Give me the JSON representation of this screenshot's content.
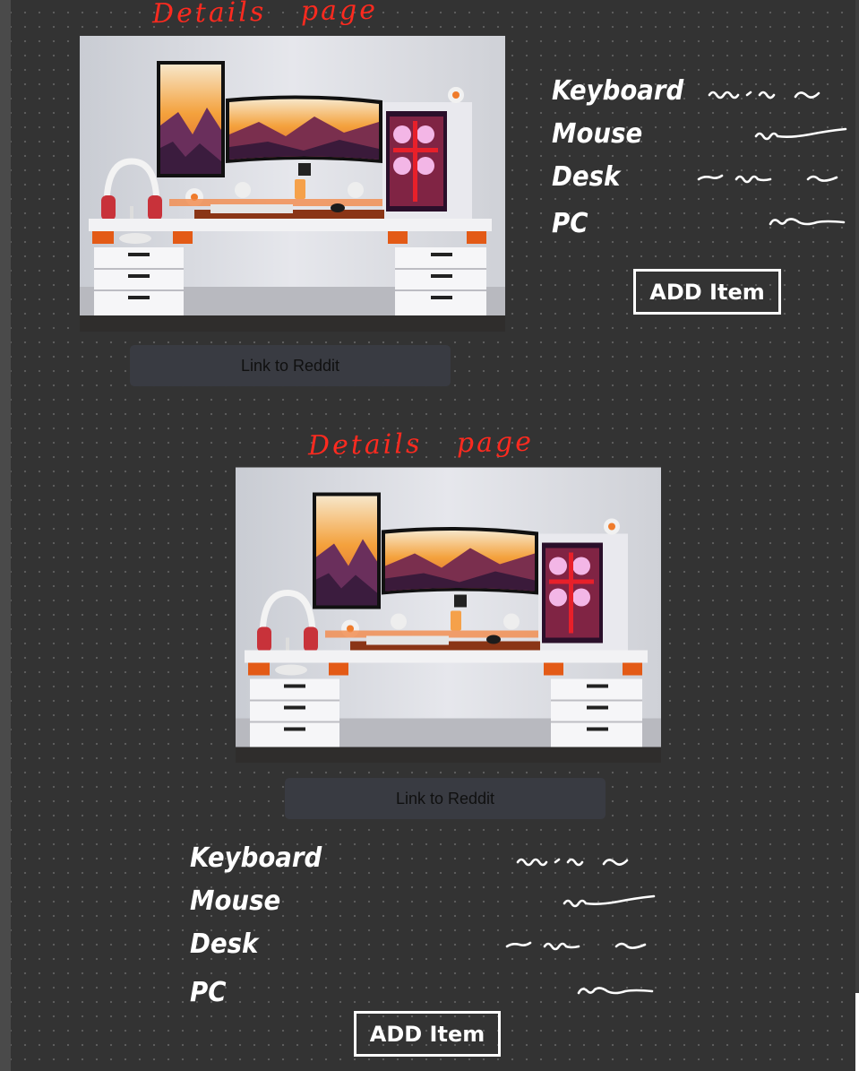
{
  "layout_a": {
    "title": "Details page",
    "link_label": "Link to Reddit",
    "specs": [
      {
        "label": "Keyboard"
      },
      {
        "label": "Mouse"
      },
      {
        "label": "Desk"
      },
      {
        "label": "PC"
      }
    ],
    "add_label": "ADD Item"
  },
  "layout_b": {
    "title": "Details page",
    "link_label": "Link to Reddit",
    "specs": [
      {
        "label": "Keyboard"
      },
      {
        "label": "Mouse"
      },
      {
        "label": "Desk"
      },
      {
        "label": "PC"
      }
    ],
    "add_label": "ADD Item"
  },
  "colors": {
    "annotation_red": "#ff2a1f",
    "canvas": "#333333",
    "button": "#393b42",
    "ink": "#ffffff"
  }
}
